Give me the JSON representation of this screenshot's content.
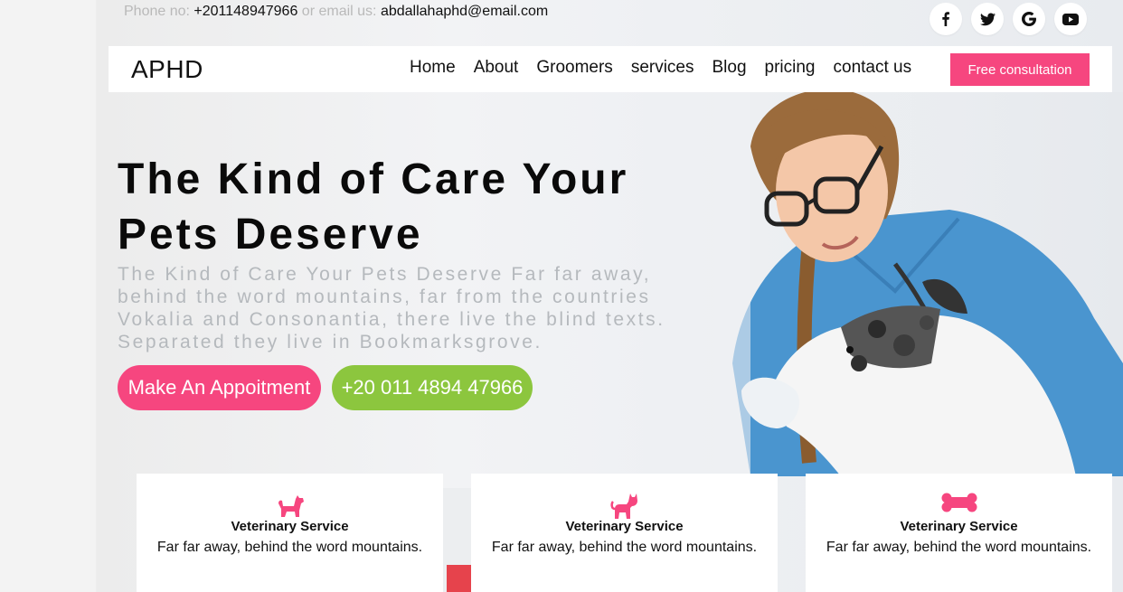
{
  "topbar": {
    "phone_label": "Phone no:",
    "phone": "+201148947966",
    "email_label": "or email us:",
    "email": "abdallahaphd@email.com"
  },
  "social": [
    {
      "icon": "facebook-icon"
    },
    {
      "icon": "twitter-icon"
    },
    {
      "icon": "google-icon"
    },
    {
      "icon": "youtube-icon"
    }
  ],
  "navbar": {
    "brand": "APHD",
    "items": [
      "Home",
      "About",
      "Groomers",
      "services",
      "Blog",
      "pricing",
      "contact us"
    ],
    "cta": "Free consultation"
  },
  "hero": {
    "title": "The Kind of Care Your Pets Deserve",
    "subtitle": "The Kind of Care Your Pets Deserve Far far away, behind the word mountains, far from the countries Vokalia and Consonantia, there live the blind texts. Separated they live in Bookmarksgrove.",
    "appointment_button": "Make An Appoitment",
    "phone_button": "+20 011 4894 47966"
  },
  "cards": [
    {
      "icon": "dog-icon",
      "title": "Veterinary Service",
      "text": "Far far away, behind the word mountains."
    },
    {
      "icon": "cat-icon",
      "title": "Veterinary Service",
      "text": "Far far away, behind the word mountains."
    },
    {
      "icon": "bone-icon",
      "title": "Veterinary Service",
      "text": "Far far away, behind the word mountains."
    }
  ],
  "colors": {
    "accent_pink": "#f6467f",
    "accent_green": "#8cc63e"
  }
}
